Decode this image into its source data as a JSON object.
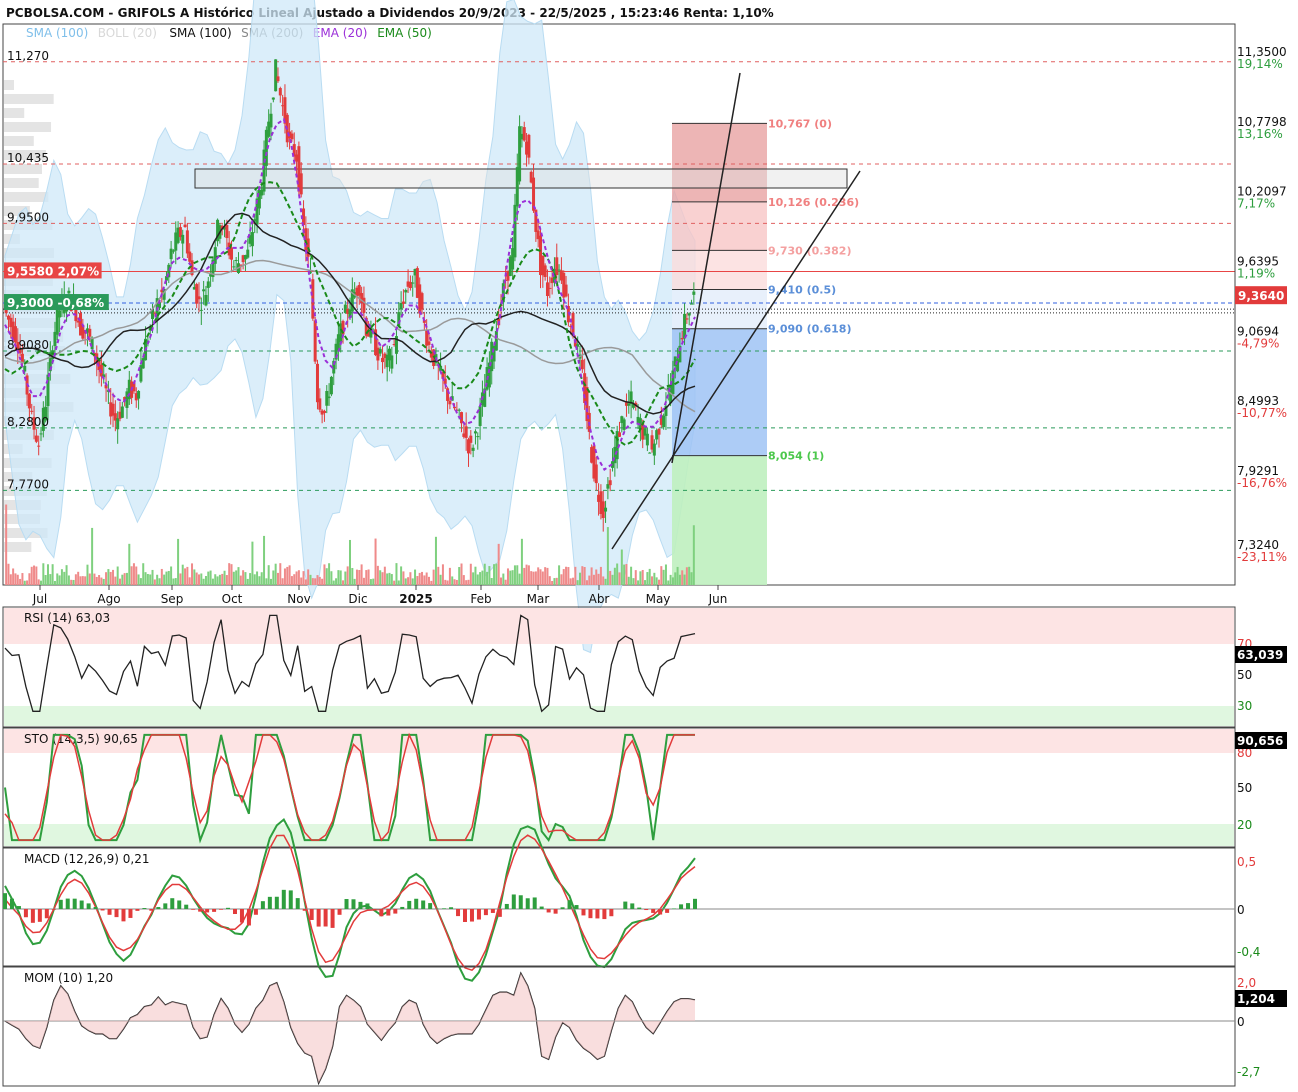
{
  "title": "PCBOLSA.COM - GRIFOLS A Histórico Lineal Ajustado a Dividendos 20/9/2023 - 22/5/2025 , 15:23:46 Renta: 1,10%",
  "legend": [
    {
      "label": "SMA (100)",
      "color": "#7fbfea"
    },
    {
      "label": "BOLL (20)",
      "color": "#d8d8d8"
    },
    {
      "label": "SMA (100)",
      "color": "#111111"
    },
    {
      "label": "SMA (200)",
      "color": "#888888"
    },
    {
      "label": "EMA (20)",
      "color": "#9b30d8"
    },
    {
      "label": "EMA (50)",
      "color": "#1a8a1a"
    }
  ],
  "chart_data": [
    {
      "type": "candlestick",
      "title": "PCBOLSA.COM - GRIFOLS A Histórico Lineal Ajustado a Dividendos 20/9/2023 - 22/5/2025 , 15:23:46 Renta: 1,10%",
      "months": [
        "Jul",
        "Ago",
        "Sep",
        "Oct",
        "Nov",
        "Dic",
        "2025",
        "Feb",
        "Mar",
        "Abr",
        "May",
        "Jun"
      ],
      "ylim": [
        7.2,
        11.45
      ],
      "right_axis_labels": [
        {
          "value": 11.35,
          "text": "11,3500",
          "pct": "19,14%"
        },
        {
          "value": 10.7798,
          "text": "10,7798",
          "pct": "13,16%"
        },
        {
          "value": 10.2097,
          "text": "10,2097",
          "pct": "7,17%"
        },
        {
          "value": 9.6395,
          "text": "9,6395",
          "pct": "1,19%"
        },
        {
          "value": 9.0694,
          "text": "9,0694",
          "pct": "-4,79%"
        },
        {
          "value": 8.4993,
          "text": "8,4993",
          "pct": "-10,77%"
        },
        {
          "value": 7.9291,
          "text": "7,9291",
          "pct": "-16,76%"
        },
        {
          "value": 7.324,
          "text": "7,3240",
          "pct": "-23,11%"
        }
      ],
      "current_price": {
        "value": 9.364,
        "text": "9,3640"
      },
      "left_levels": [
        {
          "value": 11.27,
          "text": "11,270"
        },
        {
          "value": 10.435,
          "text": "10,435"
        },
        {
          "value": 9.95,
          "text": "9,9500"
        },
        {
          "value": 9.558,
          "text": "9,5580  2,07%",
          "color": "#e84545"
        },
        {
          "value": 9.3,
          "text": "9,3000  -0,68%",
          "color": "#2a9a5a"
        },
        {
          "value": 8.908,
          "text": "8,9080"
        },
        {
          "value": 8.28,
          "text": "8,2800"
        },
        {
          "value": 7.77,
          "text": "7,7700"
        }
      ],
      "fibonacci": [
        {
          "value": 10.767,
          "text": "10,767 (0)",
          "color": "#f08080"
        },
        {
          "value": 10.126,
          "text": "10,126 (0.236)",
          "color": "#f08080"
        },
        {
          "value": 9.73,
          "text": "9,730 (0.382)",
          "color": "#f4a0a0"
        },
        {
          "value": 9.41,
          "text": "9,410 (0.5)",
          "color": "#5b8fd8"
        },
        {
          "value": 9.09,
          "text": "9,090 (0.618)",
          "color": "#5b8fd8"
        },
        {
          "value": 8.054,
          "text": "8,054 (1)",
          "color": "#4cc84c"
        }
      ],
      "close_series": [
        9.25,
        9.12,
        9.0,
        8.7,
        8.35,
        8.15,
        8.5,
        9.0,
        9.25,
        9.35,
        9.3,
        9.1,
        9.05,
        8.9,
        8.7,
        8.5,
        8.35,
        8.45,
        8.6,
        8.55,
        8.9,
        9.1,
        9.3,
        9.4,
        9.7,
        9.85,
        9.9,
        9.5,
        9.3,
        9.4,
        9.7,
        10.0,
        9.8,
        9.6,
        9.65,
        9.7,
        10.0,
        10.3,
        10.8,
        11.2,
        10.9,
        10.6,
        10.5,
        9.9,
        9.5,
        8.55,
        8.4,
        8.7,
        9.0,
        9.2,
        9.35,
        9.45,
        9.1,
        9.0,
        8.85,
        8.8,
        8.95,
        9.3,
        9.45,
        9.5,
        9.2,
        8.95,
        8.8,
        8.65,
        8.5,
        8.4,
        8.25,
        8.1,
        8.3,
        8.6,
        8.9,
        9.2,
        9.5,
        9.7,
        10.7,
        10.6,
        10.1,
        9.6,
        9.4,
        9.6,
        9.55,
        9.2,
        9.0,
        8.7,
        8.2,
        7.8,
        7.6,
        7.9,
        8.2,
        8.4,
        8.5,
        8.35,
        8.2,
        8.1,
        8.3,
        8.5,
        8.7,
        9.0,
        9.2,
        9.36
      ],
      "rsi": {
        "label": "RSI (14)",
        "value": "63,03",
        "current": "63,039",
        "levels": [
          "70",
          "50",
          "30"
        ]
      },
      "stochastic": {
        "label": "STO (14,3,5)",
        "value": "90,65",
        "current": "90,656",
        "levels": [
          "80",
          "50",
          "20"
        ]
      },
      "macd": {
        "label": "MACD (12,26,9)",
        "value": "0,21",
        "levels": [
          "0,5",
          "0",
          "-0,4"
        ]
      },
      "momentum": {
        "label": "MOM (10)",
        "value": "1,20",
        "current": "1,204",
        "levels": [
          "2,0",
          "0",
          "-2,7"
        ]
      }
    }
  ]
}
